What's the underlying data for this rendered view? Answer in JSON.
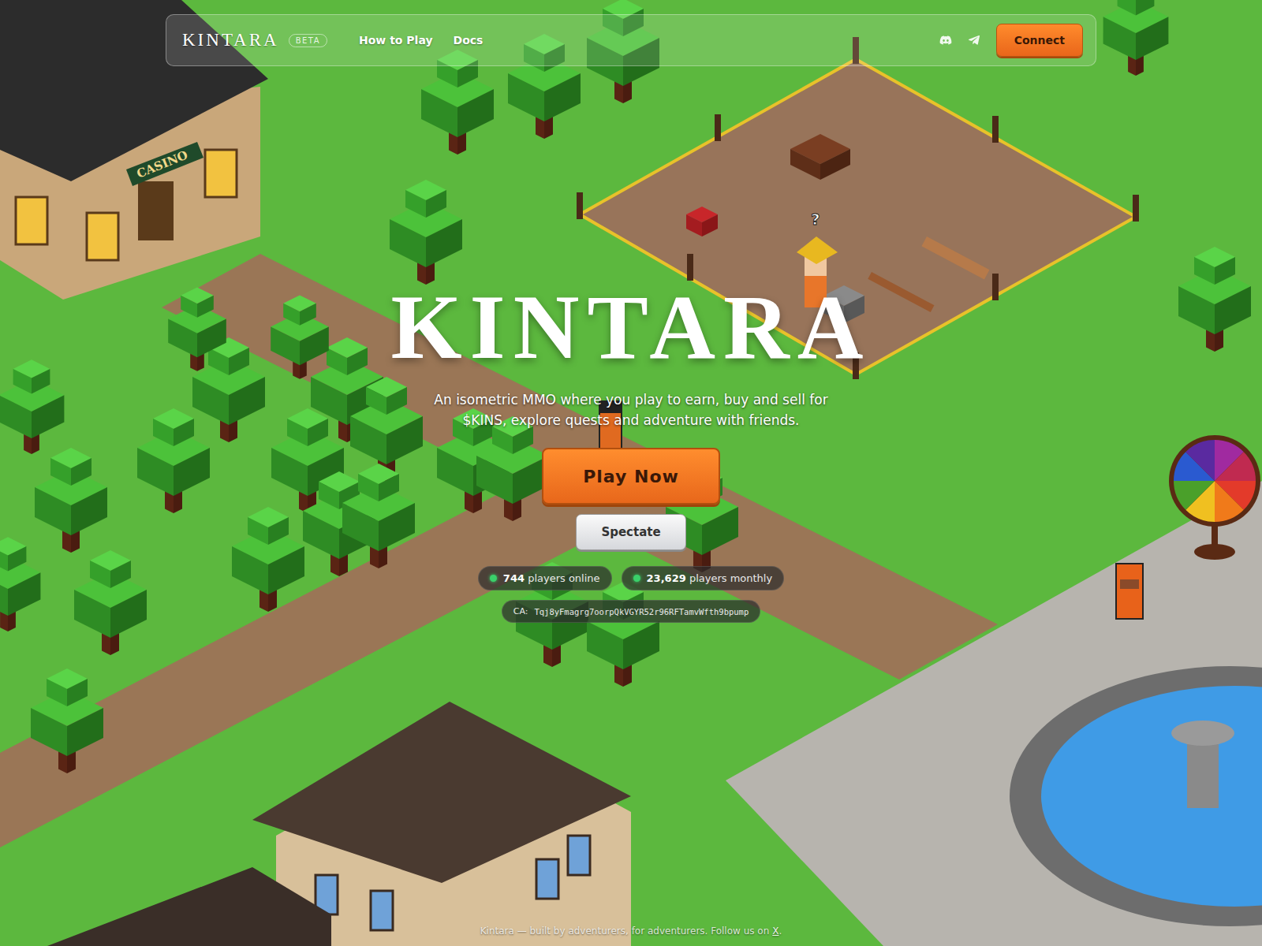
{
  "nav": {
    "logo": "KINTARA",
    "badge": "BETA",
    "links": [
      {
        "label": "How to Play"
      },
      {
        "label": "Docs"
      }
    ],
    "connect": "Connect"
  },
  "hero": {
    "title": "KINTARA",
    "subtitle": "An isometric MMO where you play to earn, buy and sell for $KINS, explore quests and adventure with friends.",
    "play": "Play Now",
    "spectate": "Spectate",
    "stats": [
      {
        "count": "744",
        "label": "players online"
      },
      {
        "count": "23,629",
        "label": "players monthly"
      }
    ],
    "contract": {
      "label": "CA:",
      "address": "Tqj8yFmagrg7oorpQkVGYR52r96RFTamvWfth9bpump"
    }
  },
  "scene": {
    "casino_sign": "CASINO",
    "npc_mark": "?"
  },
  "footer": {
    "text": "Kintara — built by adventurers, for adventurers. Follow us on",
    "link": "X",
    "end": "."
  }
}
